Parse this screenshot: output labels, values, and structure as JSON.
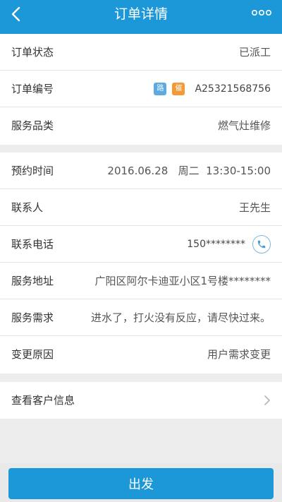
{
  "header": {
    "title": "订单详情",
    "back_icon": "chevron-left-icon",
    "more_icon": "more-dots-icon"
  },
  "order": {
    "status_label": "订单状态",
    "status_value": "已派工",
    "number_label": "订单编号",
    "number_badge_1": "路",
    "number_badge_2": "催",
    "number_value": "A25321568756",
    "category_label": "服务品类",
    "category_value": "燃气灶维修"
  },
  "details": {
    "time_label": "预约时间",
    "time_value": "2016.06.28   周二  13:30-15:00",
    "contact_label": "联系人",
    "contact_value": "王先生",
    "phone_label": "联系电话",
    "phone_value": "150********",
    "phone_icon": "phone-icon",
    "address_label": "服务地址",
    "address_value": "广阳区阿尔卡迪亚小区1号楼********",
    "need_label": "服务需求",
    "need_value": "进水了，打火没有反应，请尽快过来。",
    "change_label": "变更原因",
    "change_value": "用户需求变更"
  },
  "customer": {
    "label": "查看客户信息",
    "chevron_icon": "chevron-right-icon"
  },
  "footer": {
    "button_label": "出发"
  },
  "colors": {
    "primary": "#1c98d8",
    "badge_blue": "#5da9e0",
    "badge_orange": "#f29a3a"
  }
}
